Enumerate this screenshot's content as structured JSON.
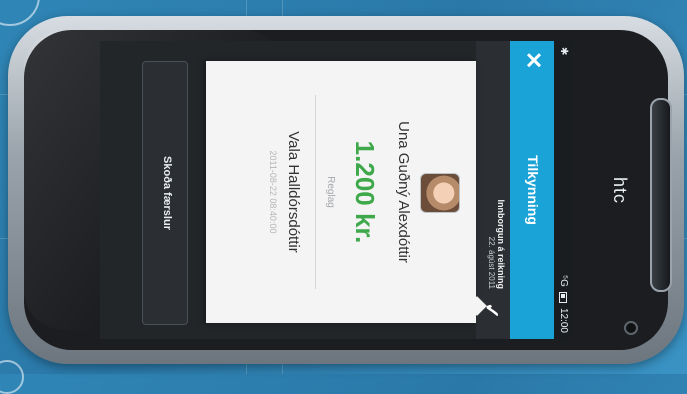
{
  "device": {
    "brand": "htc"
  },
  "statusbar": {
    "left_icon": "✱",
    "signal": "⁵G",
    "time": "12:00"
  },
  "titlebar": {
    "title": "Tilkynning",
    "close_icon": "close-icon",
    "close_glyph": "✕"
  },
  "notification": {
    "check_glyph": "✓",
    "meta_line_1": "Innborgun á reikning",
    "meta_line_2": "22. ágúst 2011",
    "name_primary": "Una Guðný Alexdóttir",
    "amount": "1.200 kr.",
    "label_small": "Reglag",
    "name_secondary": "Vala Halldórsdóttir",
    "subline": "2011-08-22 08:40:00"
  },
  "actions": {
    "primary_label": "Skoða færslur"
  },
  "colors": {
    "accent": "#1aa3d6",
    "amount": "#3ea84a",
    "background": "#2f86b6"
  }
}
